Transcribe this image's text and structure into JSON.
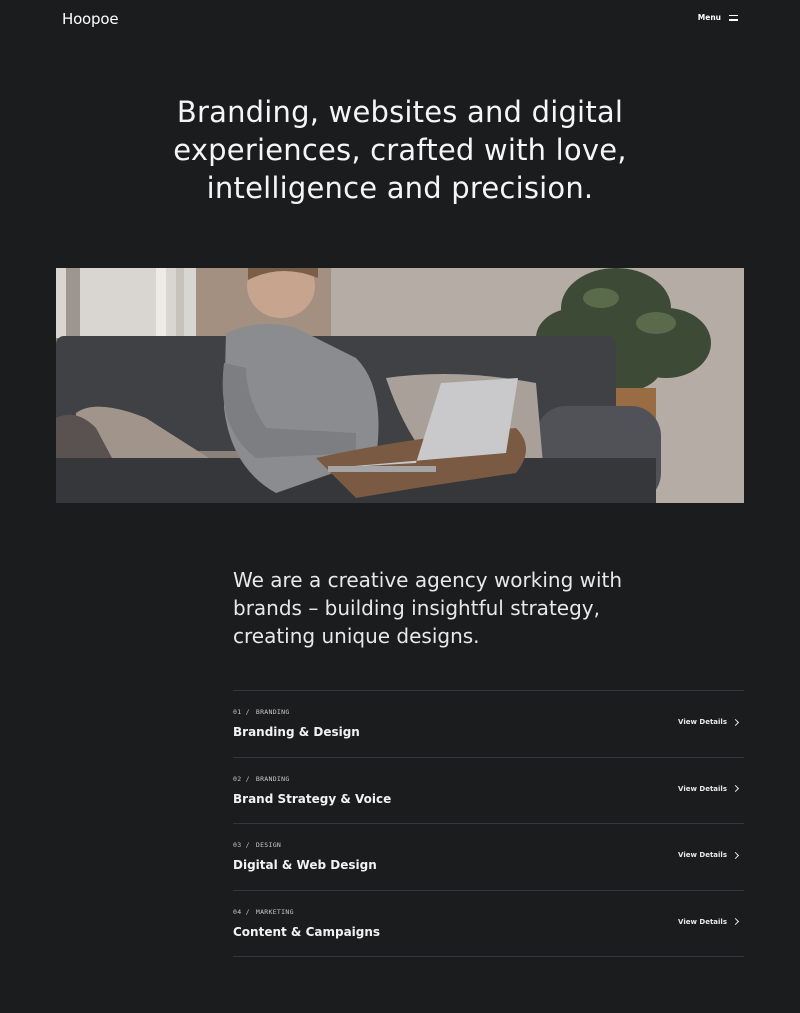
{
  "header": {
    "logo": "Hoopoe",
    "menu_label": "Menu"
  },
  "hero": {
    "line1": "Branding, websites and digital",
    "line2": "experiences, crafted with love,",
    "line3": "intelligence and precision."
  },
  "intro": {
    "line1": "We are a creative agency working with",
    "line2": "brands – building insightful strategy,",
    "line3": "creating unique designs."
  },
  "services": [
    {
      "num": "01 /",
      "category": "BRANDING",
      "title": "Branding & Design",
      "link": "View Details"
    },
    {
      "num": "02 /",
      "category": "BRANDING",
      "title": "Brand Strategy & Voice",
      "link": "View Details"
    },
    {
      "num": "03 /",
      "category": "DESIGN",
      "title": "Digital & Web Design",
      "link": "View Details"
    },
    {
      "num": "04 /",
      "category": "MARKETING",
      "title": "Content & Campaigns",
      "link": "View Details"
    }
  ]
}
